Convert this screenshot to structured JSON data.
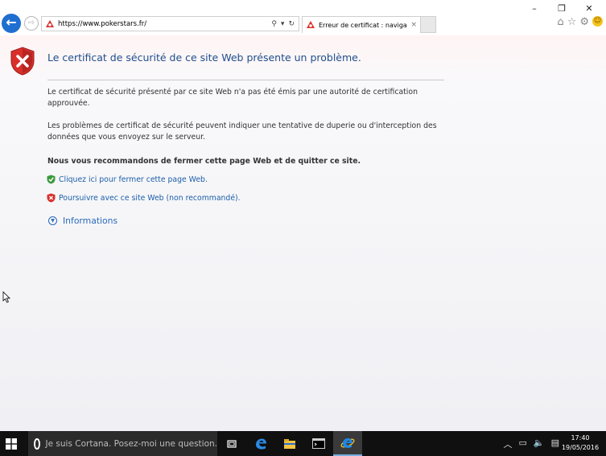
{
  "browser": {
    "url": "https://www.pokerstars.fr/",
    "tab_title": "Erreur de certificat : navigat...",
    "tab_close": "×",
    "window_controls": {
      "minimize": "–",
      "restore": "❐",
      "close": "✕"
    },
    "address_tools": {
      "search": "⚲",
      "dropdown": "▾",
      "refresh": "↻"
    },
    "back_glyph": "←",
    "forward_glyph": "⇨",
    "toolbar_icons": {
      "home": "⌂",
      "favorites": "☆",
      "settings": "⚙",
      "feedback": "☺"
    }
  },
  "error_page": {
    "title": "Le certificat de sécurité de ce site Web présente un problème.",
    "para1": "Le certificat de sécurité présenté par ce site Web n'a pas été émis par une autorité de certification approuvée.",
    "para2": "Les problèmes de certificat de sécurité peuvent indiquer une tentative de duperie ou d'interception des données que vous envoyez sur le serveur.",
    "recommendation": "Nous vous recommandons de fermer cette page Web et de quitter ce site.",
    "close_link": "Cliquez ici pour fermer cette page Web.",
    "continue_link": "Poursuivre avec ce site Web (non recommandé).",
    "info_chevron": "▼",
    "info_label": "Informations"
  },
  "taskbar": {
    "cortana_placeholder": "Je suis Cortana. Posez-moi une question.",
    "tray_icons": {
      "chevron": "︿",
      "network": "▭",
      "volume": "🔈",
      "notifications": "▤"
    },
    "time": "17:40",
    "date": "19/05/2016"
  },
  "colors": {
    "title_blue": "#1f4e8c",
    "link_blue": "#1c5ea8",
    "shield_red": "#d9302c",
    "shield_green": "#3c9a3c",
    "taskbar": "#101010",
    "ie_blue": "#1e88e5"
  }
}
